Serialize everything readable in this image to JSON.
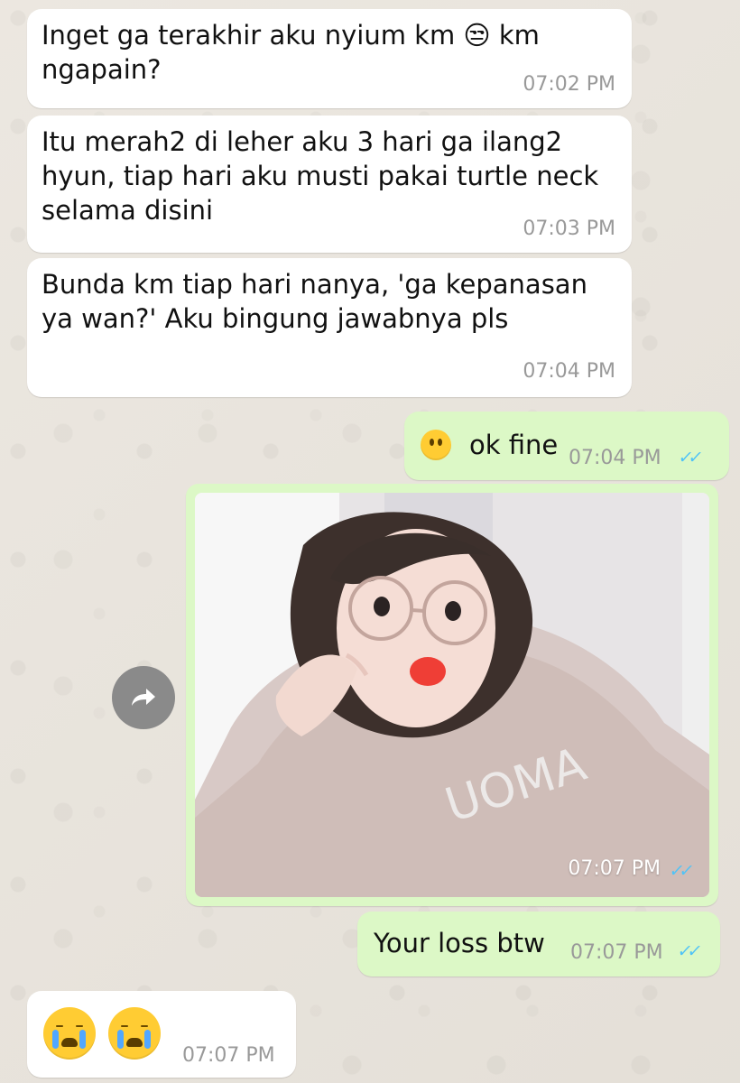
{
  "messages": [
    {
      "direction": "incoming",
      "text": "Inget ga terakhir aku nyium km 😒 km\nngapain?",
      "time": "07:02 PM"
    },
    {
      "direction": "incoming",
      "text": "Itu merah2 di leher aku 3 hari ga ilang2\nhyun, tiap hari aku musti pakai turtle neck\nselama disini",
      "time": "07:03 PM"
    },
    {
      "direction": "incoming",
      "text": "Bunda km tiap hari nanya, 'ga kepanasan\nya wan?' Aku bingung jawabnya pls",
      "time": "07:04 PM"
    },
    {
      "direction": "outgoing",
      "text": "ok fine",
      "time": "07:04 PM",
      "ticks": "✓✓"
    },
    {
      "direction": "outgoing",
      "type": "image",
      "time": "07:07 PM",
      "ticks": "✓✓",
      "image_icon": "selfie-photo"
    },
    {
      "direction": "outgoing",
      "text": "Your loss btw",
      "time": "07:07 PM",
      "ticks": "✓✓"
    },
    {
      "direction": "incoming",
      "text": "😭😭",
      "time": "07:07 PM"
    }
  ],
  "ui": {
    "forward_icon": "forward-arrow-icon",
    "colors": {
      "background": "#e9e4dc",
      "incoming_bubble": "#ffffff",
      "outgoing_bubble": "#dcf8c6",
      "timestamp": "#999999",
      "read_ticks": "#4fc3f7"
    }
  }
}
